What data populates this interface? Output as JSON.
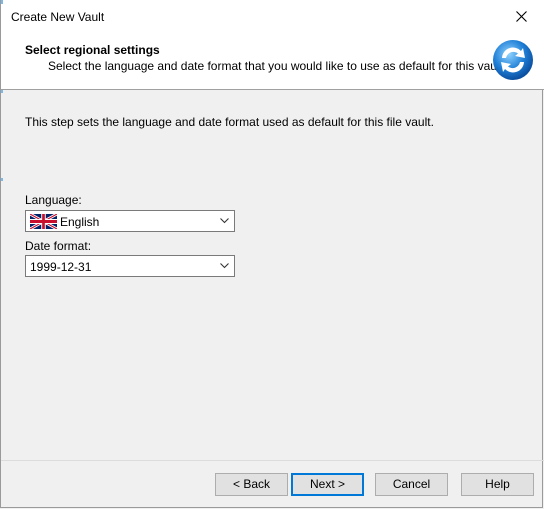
{
  "window": {
    "title": "Create New Vault"
  },
  "header": {
    "title": "Select regional settings",
    "subtitle": "Select the language and date format that you would like to use as default for this vault."
  },
  "body": {
    "intro": "This step sets the language and date format used as default for this file vault.",
    "language": {
      "label": "Language:",
      "value": "English",
      "flag_icon": "uk-flag-icon"
    },
    "date_format": {
      "label": "Date format:",
      "value": "1999-12-31"
    }
  },
  "buttons": {
    "back": "< Back",
    "next": "Next >",
    "cancel": "Cancel",
    "help": "Help"
  }
}
